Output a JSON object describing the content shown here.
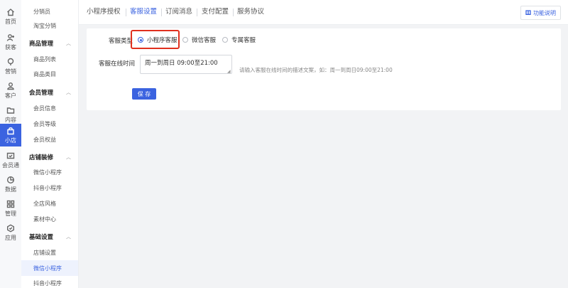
{
  "rail": {
    "items": [
      {
        "label": "首页",
        "icon": "home-icon"
      },
      {
        "label": "获客",
        "icon": "user-plus-icon"
      },
      {
        "label": "营销",
        "icon": "marketing-icon"
      },
      {
        "label": "客户",
        "icon": "customer-icon"
      },
      {
        "label": "内容",
        "icon": "folder-icon"
      },
      {
        "label": "小店",
        "icon": "shop-icon",
        "active": true
      },
      {
        "label": "会员通",
        "icon": "member-icon"
      },
      {
        "label": "数据",
        "icon": "chart-icon"
      },
      {
        "label": "管理",
        "icon": "grid-icon"
      },
      {
        "label": "应用",
        "icon": "app-icon"
      }
    ]
  },
  "menu": {
    "items": [
      {
        "type": "item",
        "label": "分销员"
      },
      {
        "type": "item",
        "label": "淘宝分销"
      },
      {
        "type": "group",
        "label": "商品管理"
      },
      {
        "type": "item",
        "label": "商品列表"
      },
      {
        "type": "item",
        "label": "商品类目"
      },
      {
        "type": "group",
        "label": "会员管理"
      },
      {
        "type": "item",
        "label": "会员信息"
      },
      {
        "type": "item",
        "label": "会员等级"
      },
      {
        "type": "item",
        "label": "会员权益"
      },
      {
        "type": "group",
        "label": "店铺装修"
      },
      {
        "type": "item",
        "label": "微信小程序"
      },
      {
        "type": "item",
        "label": "抖音小程序"
      },
      {
        "type": "item",
        "label": "全店风格"
      },
      {
        "type": "item",
        "label": "素材中心"
      },
      {
        "type": "group",
        "label": "基础设置"
      },
      {
        "type": "item",
        "label": "店铺设置"
      },
      {
        "type": "item",
        "label": "微信小程序",
        "active": true
      },
      {
        "type": "item",
        "label": "抖音小程序"
      }
    ]
  },
  "tabs": [
    {
      "label": "小程序授权"
    },
    {
      "label": "客服设置",
      "active": true
    },
    {
      "label": "订阅消息"
    },
    {
      "label": "支付配置"
    },
    {
      "label": "服务协议"
    }
  ],
  "func_button": {
    "label": "功能说明"
  },
  "form": {
    "type_label": "客服类型",
    "options": [
      {
        "label": "小程序客服",
        "checked": true
      },
      {
        "label": "微信客服"
      },
      {
        "label": "专属客服"
      }
    ],
    "online_label": "客服在线时间",
    "online_value": "周一到周日 09:00至21:00",
    "online_hint": "请输入客服在线时间的描述文案，如：周一到周日09:00至21:00",
    "save_label": "保 存"
  },
  "colors": {
    "accent": "#3b63e0",
    "highlight": "#e0301e"
  }
}
